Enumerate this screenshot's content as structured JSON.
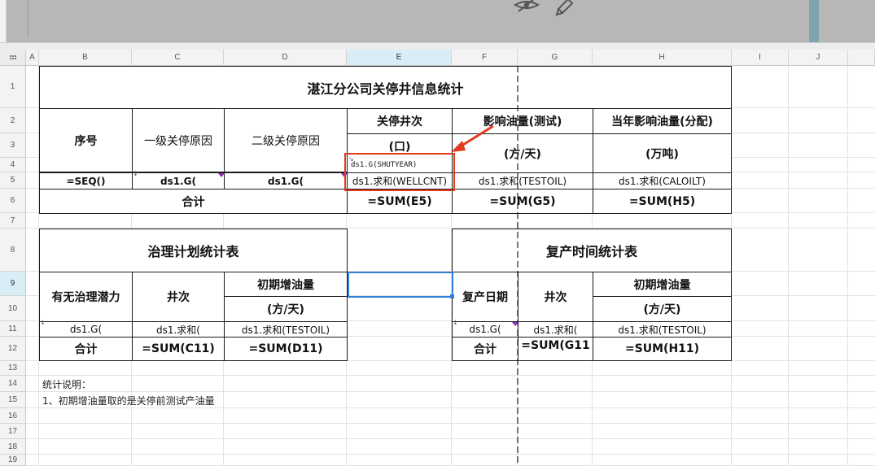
{
  "columns": [
    "A",
    "B",
    "C",
    "D",
    "E",
    "F",
    "G",
    "H",
    "I",
    "J"
  ],
  "rows": [
    "1",
    "2",
    "3",
    "4",
    "5",
    "6",
    "7",
    "8",
    "9",
    "10",
    "11",
    "12",
    "13",
    "14",
    "15",
    "16",
    "17",
    "18",
    "19"
  ],
  "selected_cell": "E9",
  "table1": {
    "title": "湛江分公司关停井信息统计",
    "h_seq": "序号",
    "h_reason1": "一级关停原因",
    "h_reason2": "二级关停原因",
    "h_wells": "关停井次",
    "h_wells_unit": "(口)",
    "h_oil_test": "影响油量(测试)",
    "h_oil_test_unit": "(方/天)",
    "h_oil_year": "当年影响油量(分配)",
    "h_oil_year_unit": "(万吨)",
    "e4_formula": "ds1.G(SHUTYEAR)",
    "r5_seq": "=SEQ()",
    "r5_reason1": "ds1.G(",
    "r5_reason2": "ds1.G(",
    "r5_wells": "ds1.求和(WELLCNT)",
    "r5_oil_test": "ds1.求和(TESTOIL)",
    "r5_oil_year": "ds1.求和(CALOILT)",
    "total_label": "合计",
    "sum_e": "=SUM(E5)",
    "sum_g": "=SUM(G5)",
    "sum_h": "=SUM(H5)"
  },
  "table2": {
    "title": "治理计划统计表",
    "h_potential": "有无治理潜力",
    "h_wells": "井次",
    "h_init_oil": "初期增油量",
    "h_unit": "(方/天)",
    "r11_b": "ds1.G(",
    "r11_c": "ds1.求和(",
    "r11_d": "ds1.求和(TESTOIL)",
    "total_label": "合计",
    "sum_c": "=SUM(C11)",
    "sum_d": "=SUM(D11)"
  },
  "table3": {
    "title": "复产时间统计表",
    "h_date": "复产日期",
    "h_wells": "井次",
    "h_init_oil": "初期增油量",
    "h_unit": "(方/天)",
    "r11_f": "ds1.G(",
    "r11_g": "ds1.求和(",
    "r11_h": "ds1.求和(TESTOIL)",
    "total_label": "合计",
    "sum_g": "=SUM(G11",
    "sum_h": "=SUM(H11)"
  },
  "notes": {
    "line1": "统计说明：",
    "line2": "1、初期增油量取的是关停前测试产油量"
  },
  "colors": {
    "highlight_red": "#e23b1f",
    "selection_blue": "#2f7fd8",
    "header_bg": "#f3f3f3",
    "selected_header_bg": "#d9edf7"
  }
}
